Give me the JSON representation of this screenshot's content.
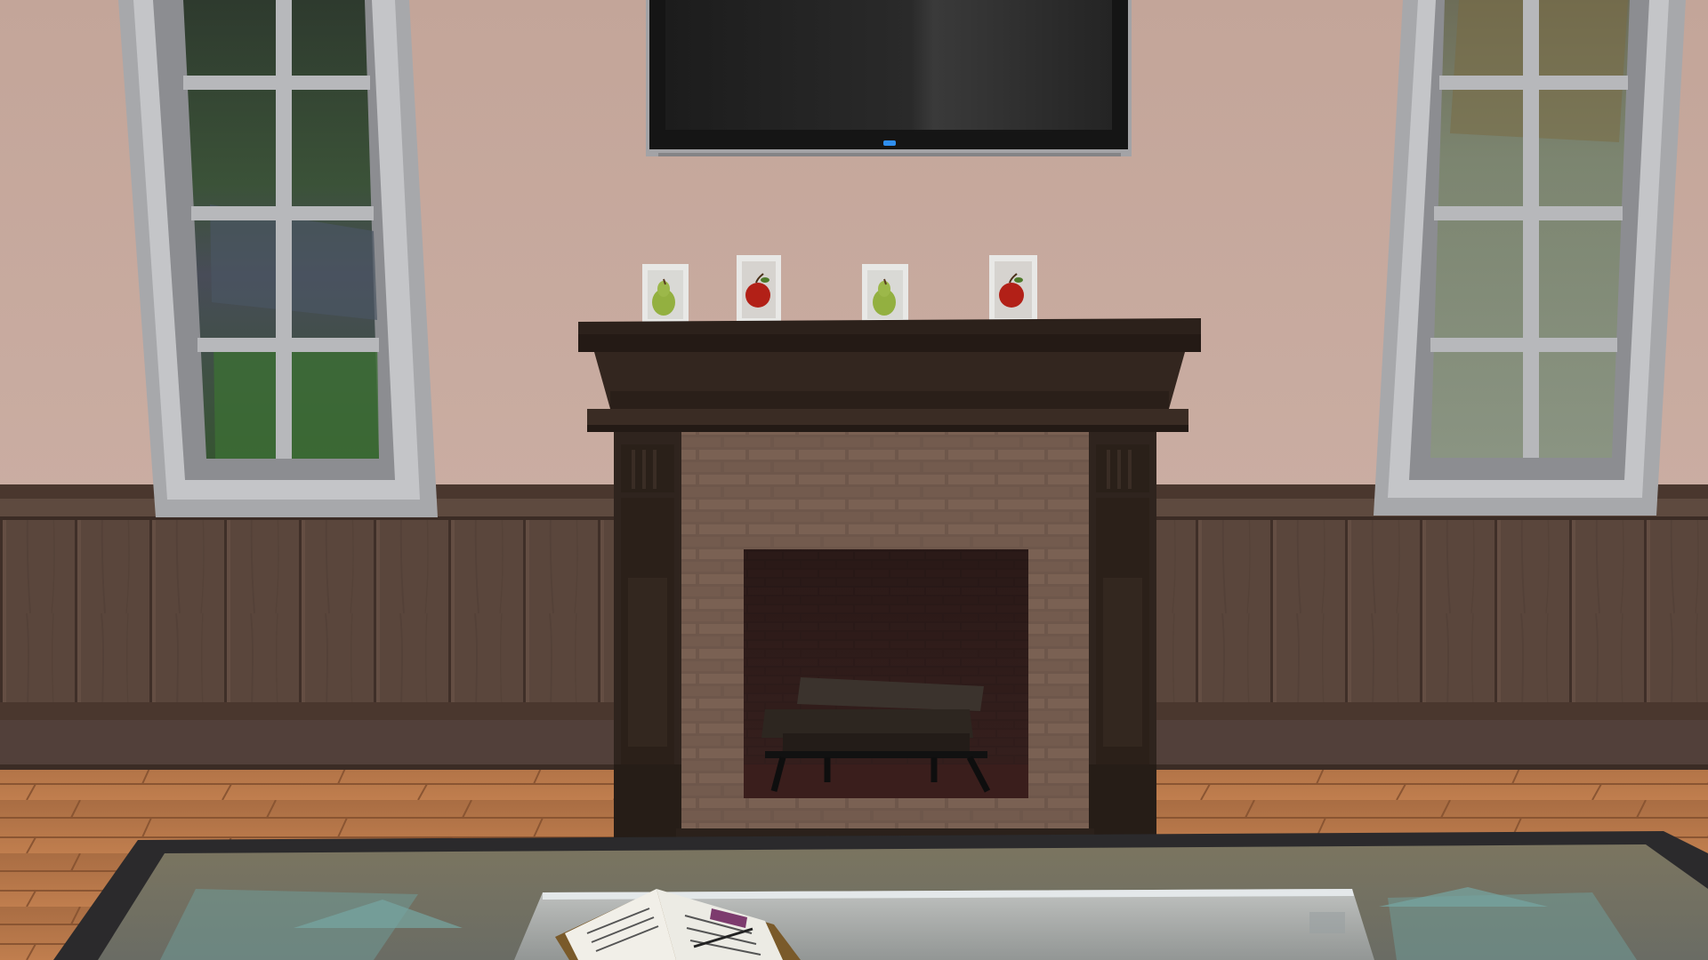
{
  "scene": {
    "type": "3D game viewport (life simulation, build mode view of a living room wall)",
    "colors": {
      "wall_paint": "#c9aca0",
      "wainscot_wood": "#5b463c",
      "chair_rail": "#4a372e",
      "floor_wood": "#b27548",
      "fireplace_wood": "#2f241e",
      "brick": "#6e574b",
      "window_frame": "#a9aaad",
      "tv_screen": "#222222",
      "tv_led": "#2f8ff0",
      "rug_border": "#2b2a2c"
    },
    "objects": [
      "wall-mounted-tv",
      "left-window",
      "right-window",
      "fireplace-mantel",
      "brick-firebox",
      "firewood-logs",
      "pear-frame-1",
      "apple-frame-1",
      "pear-frame-2",
      "apple-frame-2",
      "area-rug",
      "glass-coffee-table",
      "open-notebook"
    ]
  }
}
